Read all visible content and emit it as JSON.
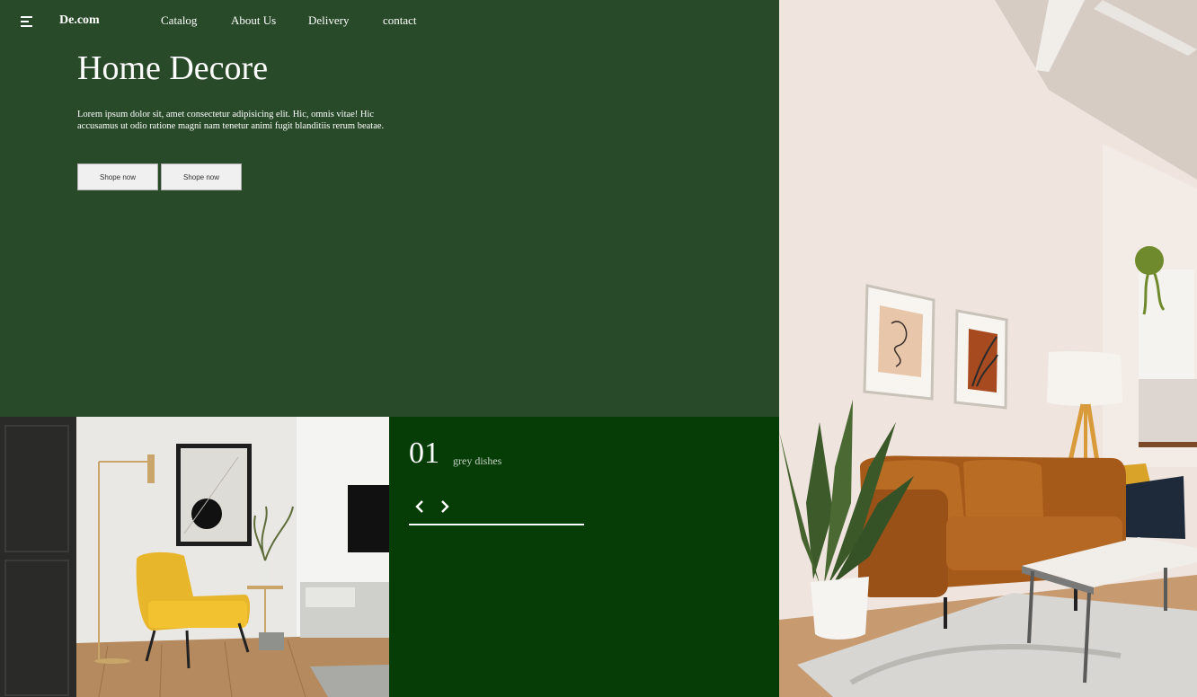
{
  "nav": {
    "logo": "De.com",
    "links": [
      "Catalog",
      "About Us",
      "Delivery",
      "contact"
    ]
  },
  "hero": {
    "title": "Home Decore",
    "description": "Lorem ipsum dolor sit, amet consectetur adipisicing elit. Hic, omnis vitae! Hic accusamus ut odio ratione magni nam tenetur animi fugit blanditiis rerum beatae.",
    "buttons": [
      "Shope now",
      "Shope now"
    ]
  },
  "slider": {
    "number": "01",
    "caption": "grey dishes"
  },
  "colors": {
    "hero_bg": "#294a29",
    "slider_bg": "#063d06",
    "button_bg": "#f0f0f0"
  },
  "icons": [
    "menu-icon",
    "arrow-left-icon",
    "arrow-right-icon"
  ]
}
